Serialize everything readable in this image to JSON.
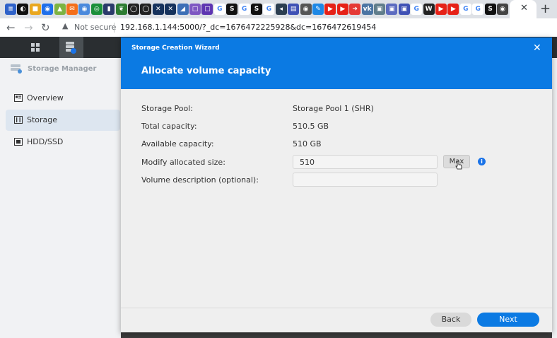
{
  "browser": {
    "tab_icons": [
      {
        "name": "bars-icon",
        "color": "#2f62c9",
        "glyph": "≡"
      },
      {
        "name": "moon-icon",
        "color": "#111111",
        "glyph": "◐"
      },
      {
        "name": "square-icon",
        "color": "#e9a71f",
        "glyph": "■"
      },
      {
        "name": "globe-icon",
        "color": "#1f6feb",
        "glyph": "◉"
      },
      {
        "name": "image-icon",
        "color": "#7cb342",
        "glyph": "▲"
      },
      {
        "name": "mail-icon",
        "color": "#f46f1b",
        "glyph": "✉"
      },
      {
        "name": "globe-icon",
        "color": "#4a89dc",
        "glyph": "◉"
      },
      {
        "name": "spiral-icon",
        "color": "#1b8f3a",
        "glyph": "◎"
      },
      {
        "name": "tag-icon",
        "color": "#2a3a6b",
        "glyph": "▮"
      },
      {
        "name": "leaf-icon",
        "color": "#2e7d32",
        "glyph": "❦"
      },
      {
        "name": "github-icon",
        "color": "#222222",
        "glyph": "◯"
      },
      {
        "name": "github-icon",
        "color": "#222222",
        "glyph": "◯"
      },
      {
        "name": "x-icon",
        "color": "#16325c",
        "glyph": "✕"
      },
      {
        "name": "x-icon",
        "color": "#16325c",
        "glyph": "✕"
      },
      {
        "name": "diagonal-icon",
        "color": "#3d6fb6",
        "glyph": "◢"
      },
      {
        "name": "square-icon",
        "color": "#7e57c2",
        "glyph": "□"
      },
      {
        "name": "square-icon",
        "color": "#5e35b1",
        "glyph": "□"
      },
      {
        "name": "google-icon",
        "color": "#ffffff",
        "glyph": "G"
      },
      {
        "name": "s-icon",
        "color": "#111111",
        "glyph": "S"
      },
      {
        "name": "google-icon",
        "color": "#ffffff",
        "glyph": "G"
      },
      {
        "name": "s-icon",
        "color": "#111111",
        "glyph": "S"
      },
      {
        "name": "google-icon",
        "color": "#ffffff",
        "glyph": "G"
      },
      {
        "name": "back-icon",
        "color": "#2c3e50",
        "glyph": "◂"
      },
      {
        "name": "doc-icon",
        "color": "#3f51b5",
        "glyph": "▤"
      },
      {
        "name": "globe-icon",
        "color": "#555555",
        "glyph": "◉"
      },
      {
        "name": "pen-icon",
        "color": "#1e88e5",
        "glyph": "✎"
      },
      {
        "name": "youtube-icon",
        "color": "#e62117",
        "glyph": "▶"
      },
      {
        "name": "youtube-icon",
        "color": "#e62117",
        "glyph": "▶"
      },
      {
        "name": "arrow-icon",
        "color": "#e53935",
        "glyph": "➜"
      },
      {
        "name": "vk-icon",
        "color": "#4c75a3",
        "glyph": "vk"
      },
      {
        "name": "image-icon",
        "color": "#607d8b",
        "glyph": "▣"
      },
      {
        "name": "square-icon",
        "color": "#5c6bc0",
        "glyph": "▣"
      },
      {
        "name": "square-icon",
        "color": "#3f51b5",
        "glyph": "▣"
      },
      {
        "name": "google-icon",
        "color": "#ffffff",
        "glyph": "G"
      },
      {
        "name": "wp-icon",
        "color": "#222222",
        "glyph": "W"
      },
      {
        "name": "youtube-icon",
        "color": "#e62117",
        "glyph": "▶"
      },
      {
        "name": "youtube-icon",
        "color": "#e62117",
        "glyph": "▶"
      },
      {
        "name": "google-icon",
        "color": "#ffffff",
        "glyph": "G"
      },
      {
        "name": "google-icon",
        "color": "#ffffff",
        "glyph": "G"
      },
      {
        "name": "s-icon",
        "color": "#111111",
        "glyph": "S"
      },
      {
        "name": "globe-icon",
        "color": "#444444",
        "glyph": "◉"
      }
    ],
    "active_tab_close": "✕",
    "new_tab": "+",
    "not_secure": "Not secure",
    "url": "192.168.1.144:5000/?_dc=1676472225928&dc=1676472619454"
  },
  "sidebar": {
    "app_title": "Storage Manager",
    "items": [
      {
        "label": "Overview"
      },
      {
        "label": "Storage"
      },
      {
        "label": "HDD/SSD"
      }
    ]
  },
  "dialog": {
    "wizard_title": "Storage Creation Wizard",
    "step_title": "Allocate volume capacity",
    "close": "✕",
    "rows": {
      "pool_label": "Storage Pool:",
      "pool_value": "Storage Pool 1 (SHR)",
      "total_label": "Total capacity:",
      "total_value": "510.5 GB",
      "avail_label": "Available capacity:",
      "avail_value": "510 GB",
      "size_label": "Modify allocated size:",
      "size_value": "510",
      "desc_label": "Volume description (optional):",
      "desc_value": ""
    },
    "max_label": "Max",
    "info_glyph": "i",
    "back_label": "Back",
    "next_label": "Next"
  },
  "colors": {
    "accent": "#0b7ae3"
  }
}
